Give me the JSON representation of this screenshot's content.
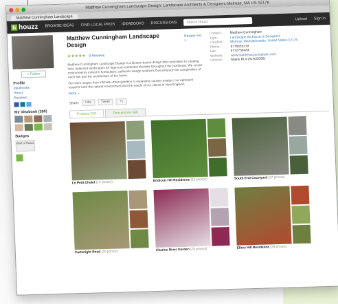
{
  "window": {
    "title": "Matthew Cunningham Landscape Design: Landscape Architects & Designers Melrose, MA US 02176",
    "tab": "Matthew Cunningham Landscape"
  },
  "nav": {
    "logo": "houzz",
    "items": [
      "BROWSE IDEAS",
      "FIND LOCAL PROS",
      "IDEABOOKS",
      "DISCUSSIONS"
    ],
    "search_placeholder": "Search Houzz",
    "right_items": [
      "Upload",
      "Sign In"
    ]
  },
  "sidebar": {
    "follow_label": "+ Follow",
    "profile_heading": "Profile",
    "profile_links": [
      "Ideabooks",
      "Houzz",
      "Reviews"
    ],
    "followers_heading": "My Ideabook (380)",
    "badges_heading": "Badges",
    "badge_label": "Best of Houzz"
  },
  "profile": {
    "name": "Matthew Cunningham Landscape Design",
    "review_link": "Review me »",
    "stars": "★★★★★",
    "reviews": "8 Reviews",
    "description": [
      "Matthew Cunningham Landscape Design is a Boston-based design firm committed to creating lush, balanced landscapes for high-end residential clientele throughout the Northeast. We create environments rooted in horticulture, authentic design solutions that embrace the complexities of each site and the architecture of the home.",
      "Our work ranges from intimate urban gardens to expansive country estates; our approach respects both the natural environment and the needs of our clients in New England."
    ],
    "more_link": "More »",
    "info": [
      {
        "k": "Contact:",
        "v": "Matthew Cunningham",
        "link": false
      },
      {
        "k": "Type:",
        "v": "Landscape Architects & Designers",
        "link": true
      },
      {
        "k": "Location:",
        "v": "Melrose, Massachusetts, United States 02176",
        "link": true
      },
      {
        "k": "Phone:",
        "v": "8778655219",
        "link": false
      },
      {
        "k": "Fax:",
        "v": "8772730424",
        "link": false
      },
      {
        "k": "Website:",
        "v": "www.matthewcunningham.com",
        "link": true
      },
      {
        "k": "License:",
        "v": "Maine RLA (#LA32056)",
        "link": false
      }
    ],
    "share_label": "Share:",
    "share_buttons": [
      "Like",
      "Tweet",
      "+1"
    ]
  },
  "tabs": [
    "Projects (97)",
    "Discussions (84)"
  ],
  "projects": [
    {
      "title": "Le Petit Chalet",
      "count": "(14 photos)",
      "c1": "#6b4a34",
      "c2": "#8d9f78",
      "c3": "#a9b9c0"
    },
    {
      "title": "Endicott Hill Residence",
      "count": "(15 photos)",
      "c1": "#3f6e2a",
      "c2": "#5e8e3d",
      "c3": "#7a6644"
    },
    {
      "title": "South End Courtyard",
      "count": "(27 photos)",
      "c1": "#49613a",
      "c2": "#8a8a84",
      "c3": "#9aa6a0"
    },
    {
      "title": "Cartwright Road",
      "count": "(20 photos)",
      "c1": "#6e8a44",
      "c2": "#a89877",
      "c3": "#8c5a3b"
    },
    {
      "title": "Charles River Garden",
      "count": "(20 photos)",
      "c1": "#8c2a54",
      "c2": "#e5dfe3",
      "c3": "#b6a3b2"
    },
    {
      "title": "Ellery Hill Residence",
      "count": "(28 photos)",
      "c1": "#6f7f40",
      "c2": "#b24a30",
      "c3": "#8fa85c"
    }
  ],
  "colors": {
    "accent": "#7ab648",
    "link": "#3a7ab8",
    "navbar": "#2b2b2b"
  }
}
